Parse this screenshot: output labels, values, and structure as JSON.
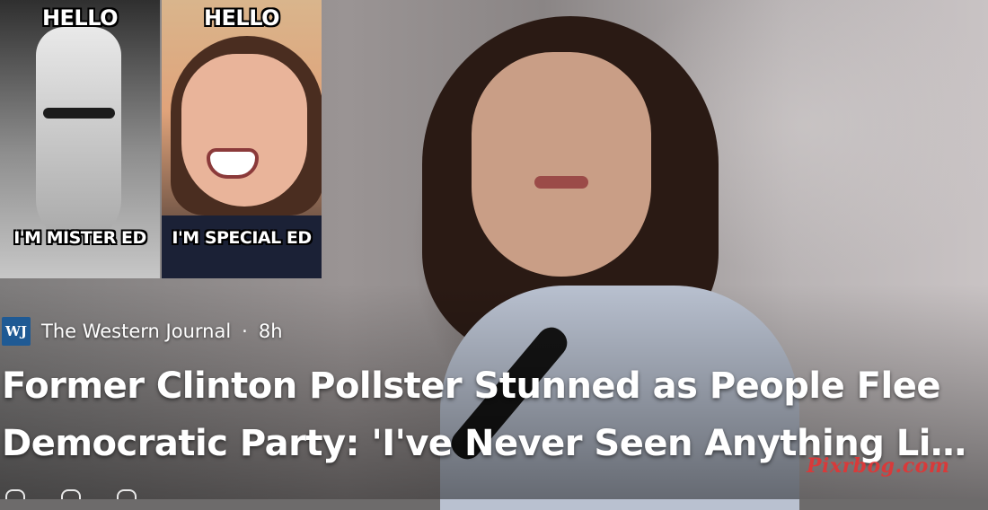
{
  "meme": {
    "left_panel": {
      "top_text": "HELLO",
      "bottom_text": "I'M MISTER ED"
    },
    "right_panel": {
      "top_text": "HELLO",
      "bottom_text": "I'M SPECIAL ED"
    }
  },
  "article": {
    "publisher_logo_text": "WJ",
    "publisher_name": "The Western Journal",
    "separator": "·",
    "time_ago": "8h",
    "headline_line1": "Former Clinton Pollster Stunned as People Flee",
    "headline_line2": "Democratic Party: 'I've Never Seen Anything Like..."
  },
  "watermark": "Pixrbog.com",
  "colors": {
    "publisher_logo_bg": "#1f5a94",
    "watermark": "#d83a3a",
    "text": "#ffffff"
  },
  "action_bar": {
    "icons": [
      "like-icon",
      "comment-icon",
      "share-icon"
    ]
  }
}
